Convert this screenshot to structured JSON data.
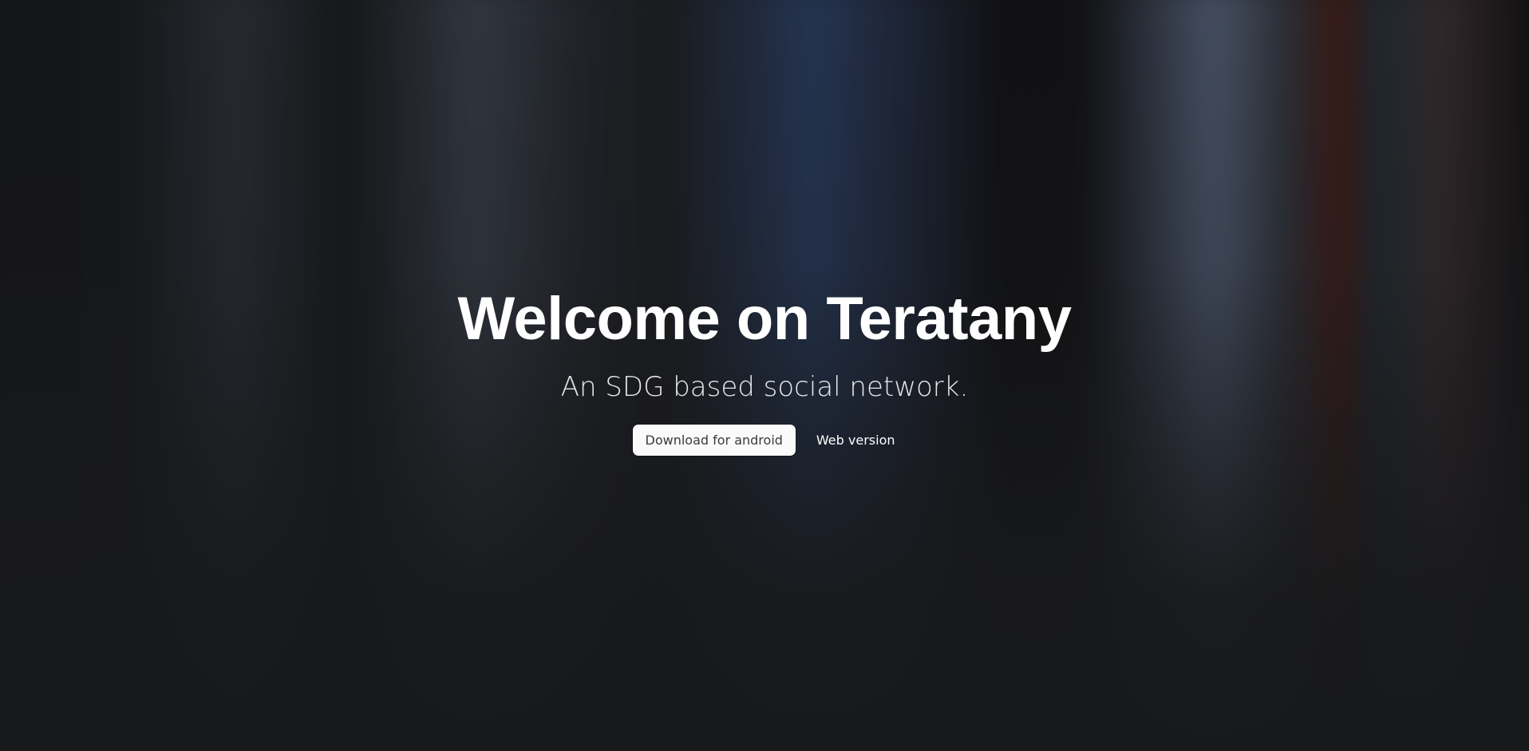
{
  "hero": {
    "title": "Welcome on Teratany",
    "subtitle": "An SDG based social network."
  },
  "actions": {
    "download_label": "Download for android",
    "web_label": "Web version"
  },
  "colors": {
    "background": "#18191b",
    "primary_button_bg": "#fafafa",
    "primary_button_text": "#3a3a3c",
    "text": "#ffffff"
  }
}
